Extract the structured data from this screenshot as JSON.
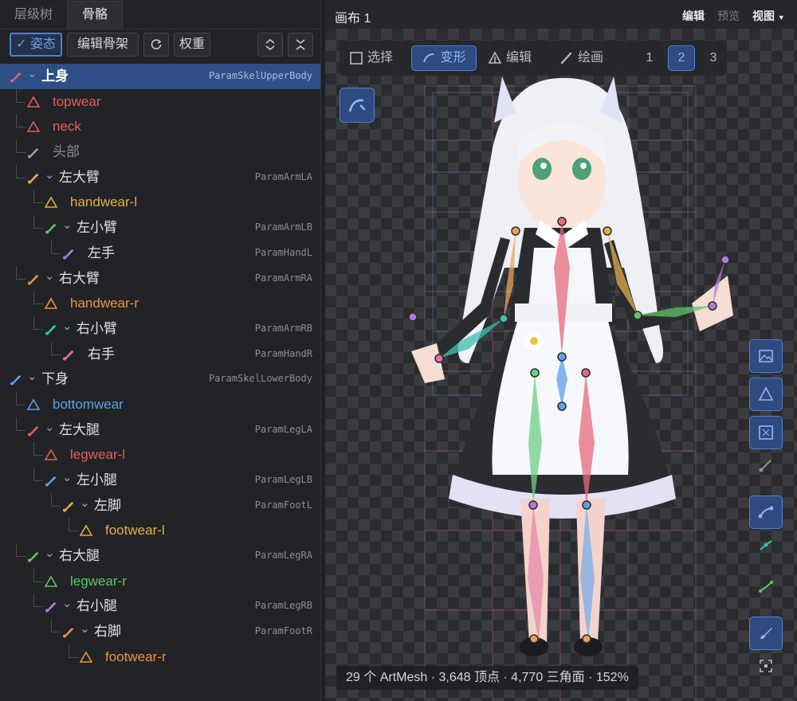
{
  "left_panel": {
    "tabs": [
      {
        "label": "层级树",
        "active": false
      },
      {
        "label": "骨骼",
        "active": true
      }
    ],
    "toolbar": {
      "pose_label": "姿态",
      "edit_skeleton_label": "编辑骨架",
      "weight_label": "权重"
    },
    "tree": [
      {
        "label": "上身",
        "param": "ParamSkelUpperBody",
        "icon": "bone-icon",
        "color": "#e35d73",
        "depth": 0,
        "expandable": true,
        "selected": true
      },
      {
        "label": "topwear",
        "param": "",
        "icon": "mesh-triangle-icon",
        "color": "#e35d5d",
        "depth": 1
      },
      {
        "label": "neck",
        "param": "",
        "icon": "mesh-triangle-icon",
        "color": "#e35d5d",
        "depth": 1
      },
      {
        "label": "头部",
        "param": "",
        "icon": "bone-icon",
        "color": "#9a9da3",
        "depth": 1,
        "muted": true
      },
      {
        "label": "左大臂",
        "param": "ParamArmLA",
        "icon": "bone-icon",
        "color": "#e0b04a",
        "depth": 1,
        "expandable": true
      },
      {
        "label": "handwear-l",
        "param": "",
        "icon": "mesh-triangle-icon",
        "color": "#e0b04a",
        "depth": 2
      },
      {
        "label": "左小臂",
        "param": "ParamArmLB",
        "icon": "bone-icon",
        "color": "#5fc46a",
        "depth": 2,
        "expandable": true
      },
      {
        "label": "左手",
        "param": "ParamHandL",
        "icon": "bone-icon",
        "color": "#b07adf",
        "depth": 3
      },
      {
        "label": "右大臂",
        "param": "ParamArmRA",
        "icon": "bone-icon",
        "color": "#e89447",
        "depth": 1,
        "expandable": true
      },
      {
        "label": "handwear-r",
        "param": "",
        "icon": "mesh-triangle-icon",
        "color": "#e89447",
        "depth": 2
      },
      {
        "label": "右小臂",
        "param": "ParamArmRB",
        "icon": "bone-icon",
        "color": "#3fbfb0",
        "depth": 2,
        "expandable": true
      },
      {
        "label": "右手",
        "param": "ParamHandR",
        "icon": "bone-icon",
        "color": "#e86fa8",
        "depth": 3
      },
      {
        "label": "下身",
        "param": "ParamSkelLowerBody",
        "icon": "bone-icon",
        "color": "#5fa0e6",
        "depth": 0,
        "expandable": true
      },
      {
        "label": "bottomwear",
        "param": "",
        "icon": "mesh-triangle-icon",
        "color": "#5fa0e6",
        "depth": 1
      },
      {
        "label": "左大腿",
        "param": "ParamLegLA",
        "icon": "bone-icon",
        "color": "#e35d5d",
        "depth": 1,
        "expandable": true
      },
      {
        "label": "legwear-l",
        "param": "",
        "icon": "mesh-triangle-icon",
        "color": "#e35d5d",
        "depth": 2
      },
      {
        "label": "左小腿",
        "param": "ParamLegLB",
        "icon": "bone-icon",
        "color": "#5fa0e6",
        "depth": 2,
        "expandable": true
      },
      {
        "label": "左脚",
        "param": "ParamFootL",
        "icon": "bone-icon",
        "color": "#e0b04a",
        "depth": 3,
        "expandable": true
      },
      {
        "label": "footwear-l",
        "param": "",
        "icon": "mesh-triangle-icon",
        "color": "#e0b04a",
        "depth": 4
      },
      {
        "label": "右大腿",
        "param": "ParamLegRA",
        "icon": "bone-icon",
        "color": "#5fc46a",
        "depth": 1,
        "expandable": true
      },
      {
        "label": "legwear-r",
        "param": "",
        "icon": "mesh-triangle-icon",
        "color": "#5fc46a",
        "depth": 2
      },
      {
        "label": "右小腿",
        "param": "ParamLegRB",
        "icon": "bone-icon",
        "color": "#b07adf",
        "depth": 2,
        "expandable": true
      },
      {
        "label": "右脚",
        "param": "ParamFootR",
        "icon": "bone-icon",
        "color": "#e89447",
        "depth": 3,
        "expandable": true
      },
      {
        "label": "footwear-r",
        "param": "",
        "icon": "mesh-triangle-icon",
        "color": "#e89447",
        "depth": 4
      }
    ]
  },
  "canvas_panel": {
    "title": "画布 1",
    "menu": {
      "edit": "编辑",
      "preview": "预览",
      "view": "视图"
    },
    "modes": {
      "select": "选择",
      "deform": "变形",
      "edit": "编辑",
      "paint": "绘画",
      "page_1": "1",
      "page_2": "2",
      "page_3": "3"
    },
    "active_mode": "变形",
    "active_page": "2",
    "side_tools": [
      "image-icon",
      "mesh-triangle-icon",
      "warp-deformer-icon",
      "bone-segment-icon",
      "bone-curve-icon",
      "bone-link-icon",
      "bone-chain-icon",
      "brush-icon",
      "focus-frame-icon"
    ],
    "status": "29 个 ArtMesh · 3,648 顶点 · 4,770 三角面 · 152%"
  },
  "colors": {
    "accent": "#4f7fd8",
    "selected_row": "#2e4f86"
  }
}
